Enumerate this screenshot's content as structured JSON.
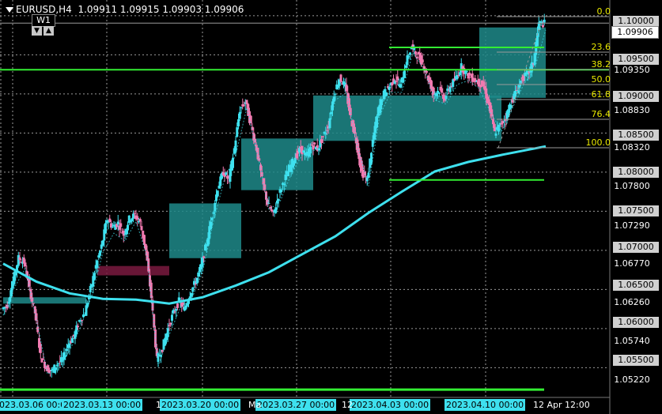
{
  "header": {
    "symbol_info": "EURUSD,H4",
    "prices": "1.09911  1.09915  1.09903  1.09906"
  },
  "timeframe": {
    "label": "W1",
    "down_icon": "triangle-down-icon",
    "up_icon": "triangle-up-icon"
  },
  "price_axis": {
    "current_price": "1.09906",
    "boxed_labels": [
      "1.10000",
      "1.09500",
      "1.09000",
      "1.08500",
      "1.08000",
      "1.07500",
      "1.07000",
      "1.06500",
      "1.06000",
      "1.05500"
    ],
    "plain_labels": [
      "1.09350",
      "1.08830",
      "1.08320",
      "1.07800",
      "1.07290",
      "1.06770",
      "1.06260",
      "1.05740",
      "1.05220"
    ]
  },
  "time_axis": {
    "boxed_labels": [
      "2023.03.06 00:00",
      "2023.03.13 00:00",
      "2023.03.20 00:00",
      "2023.03.27 00:00",
      "2023.04.03 00:00",
      "2023.04.10 00:00"
    ],
    "plain_labels": [
      "1",
      "Ma",
      "12",
      "12 Apr 12:00"
    ]
  },
  "fibonacci": {
    "levels": [
      "0.0",
      "23.6",
      "38.2",
      "50.0",
      "61.8",
      "76.4",
      "100.0"
    ],
    "color": "#e8e800"
  },
  "colors": {
    "background": "#000000",
    "bull_candle": "#3ee0ee",
    "bear_candle": "#f07ab0",
    "moving_average": "#3ee0ee",
    "support_lines": "#33ee33",
    "demand_zone": "#1e8a8a",
    "supply_zone": "#7a1a40",
    "grid": "#9a9a9a"
  },
  "chart_data": {
    "type": "candlestick",
    "symbol": "EURUSD",
    "timeframe": "H4",
    "ylim": [
      1.0515,
      1.101
    ],
    "x_range_days": [
      "2023-03-06",
      "2023-04-12"
    ],
    "price_path": [
      [
        0,
        1.0625
      ],
      [
        1,
        1.063
      ],
      [
        2,
        1.066
      ],
      [
        3,
        1.069
      ],
      [
        4,
        1.0685
      ],
      [
        5,
        1.065
      ],
      [
        6,
        1.062
      ],
      [
        7,
        1.0565
      ],
      [
        8,
        1.055
      ],
      [
        9,
        1.0545
      ],
      [
        10,
        1.0555
      ],
      [
        11,
        1.056
      ],
      [
        12,
        1.058
      ],
      [
        13,
        1.059
      ],
      [
        14,
        1.061
      ],
      [
        15,
        1.062
      ],
      [
        16,
        1.065
      ],
      [
        17,
        1.068
      ],
      [
        18,
        1.0705
      ],
      [
        19,
        1.074
      ],
      [
        20,
        1.073
      ],
      [
        21,
        1.0735
      ],
      [
        22,
        1.072
      ],
      [
        23,
        1.074
      ],
      [
        24,
        1.0745
      ],
      [
        25,
        1.0735
      ],
      [
        26,
        1.07
      ],
      [
        27,
        1.064
      ],
      [
        28,
        1.056
      ],
      [
        29,
        1.0575
      ],
      [
        30,
        1.06
      ],
      [
        31,
        1.062
      ],
      [
        32,
        1.0635
      ],
      [
        33,
        1.0625
      ],
      [
        34,
        1.0645
      ],
      [
        35,
        1.066
      ],
      [
        36,
        1.068
      ],
      [
        37,
        1.071
      ],
      [
        38,
        1.0745
      ],
      [
        39,
        1.078
      ],
      [
        40,
        1.08
      ],
      [
        41,
        1.079
      ],
      [
        42,
        1.083
      ],
      [
        43,
        1.088
      ],
      [
        44,
        1.089
      ],
      [
        45,
        1.086
      ],
      [
        46,
        1.083
      ],
      [
        47,
        1.079
      ],
      [
        48,
        1.076
      ],
      [
        49,
        1.0745
      ],
      [
        50,
        1.077
      ],
      [
        51,
        1.079
      ],
      [
        52,
        1.0805
      ],
      [
        53,
        1.082
      ],
      [
        54,
        1.083
      ],
      [
        55,
        1.082
      ],
      [
        56,
        1.0835
      ],
      [
        57,
        1.083
      ],
      [
        58,
        1.0845
      ],
      [
        59,
        1.086
      ],
      [
        60,
        1.09
      ],
      [
        61,
        1.092
      ],
      [
        62,
        1.091
      ],
      [
        63,
        1.087
      ],
      [
        64,
        1.084
      ],
      [
        65,
        1.08
      ],
      [
        66,
        1.079
      ],
      [
        67,
        1.084
      ],
      [
        68,
        1.088
      ],
      [
        69,
        1.09
      ],
      [
        70,
        1.091
      ],
      [
        71,
        1.092
      ],
      [
        72,
        1.091
      ],
      [
        73,
        1.094
      ],
      [
        74,
        1.096
      ],
      [
        75,
        1.095
      ],
      [
        76,
        1.094
      ],
      [
        77,
        1.092
      ],
      [
        78,
        1.09
      ],
      [
        79,
        1.0905
      ],
      [
        80,
        1.0895
      ],
      [
        81,
        1.091
      ],
      [
        82,
        1.092
      ],
      [
        83,
        1.0935
      ],
      [
        84,
        1.0925
      ],
      [
        85,
        1.092
      ],
      [
        86,
        1.0915
      ],
      [
        87,
        1.091
      ],
      [
        88,
        1.0885
      ],
      [
        89,
        1.085
      ],
      [
        90,
        1.086
      ],
      [
        91,
        1.087
      ],
      [
        92,
        1.089
      ],
      [
        93,
        1.0905
      ],
      [
        94,
        1.092
      ],
      [
        95,
        1.0925
      ],
      [
        96,
        1.094
      ],
      [
        97,
        1.099
      ],
      [
        98,
        1.099
      ]
    ],
    "moving_average": [
      [
        0,
        1.0683
      ],
      [
        6,
        1.066
      ],
      [
        12,
        1.0645
      ],
      [
        18,
        1.0638
      ],
      [
        24,
        1.0637
      ],
      [
        30,
        1.0632
      ],
      [
        36,
        1.064
      ],
      [
        42,
        1.0655
      ],
      [
        48,
        1.0672
      ],
      [
        54,
        1.0695
      ],
      [
        60,
        1.0718
      ],
      [
        66,
        1.0748
      ],
      [
        72,
        1.0775
      ],
      [
        78,
        1.0801
      ],
      [
        84,
        1.0813
      ],
      [
        90,
        1.0822
      ],
      [
        98,
        1.0833
      ]
    ],
    "horizontal_levels": [
      1.0931,
      1.0917,
      1.079,
      1.0522
    ],
    "zones": [
      {
        "kind": "demand",
        "x0": 0,
        "x1": 15,
        "y0": 1.064,
        "y1": 1.0632
      },
      {
        "kind": "supply",
        "x0": 17,
        "x1": 30,
        "y0": 1.068,
        "y1": 1.0668
      },
      {
        "kind": "demand",
        "x0": 30,
        "x1": 43,
        "y0": 1.076,
        "y1": 1.069
      },
      {
        "kind": "demand",
        "x0": 43,
        "x1": 56,
        "y0": 1.0843,
        "y1": 1.0777
      },
      {
        "kind": "demand",
        "x0": 56,
        "x1": 70,
        "y0": 1.0898,
        "y1": 1.084
      },
      {
        "kind": "demand",
        "x0": 70,
        "x1": 90,
        "y0": 1.0898,
        "y1": 1.084
      },
      {
        "kind": "demand",
        "x0": 86,
        "x1": 98,
        "y0": 1.0985,
        "y1": 1.0895
      }
    ]
  }
}
